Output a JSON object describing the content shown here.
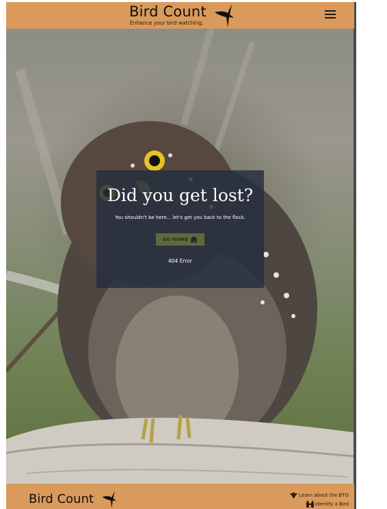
{
  "header": {
    "brand_title": "Bird Count",
    "brand_tagline": "Enhance your bird watching.",
    "menu_icon": "hamburger-menu-icon"
  },
  "hero": {
    "image_subject": "owl-photo"
  },
  "lost_card": {
    "title": "Did you get lost?",
    "subtitle": "You shouldn't be here... let's get you back to the flock.",
    "button_label": "GO HOME",
    "button_icon": "home-icon",
    "error_text": "404 Error"
  },
  "footer": {
    "brand_title": "Bird Count",
    "links": [
      {
        "label": "Learn about the BTO",
        "icon": "bird-icon"
      },
      {
        "label": "Identify a Bird",
        "icon": "binoculars-icon"
      }
    ]
  },
  "colors": {
    "header_bg": "#d99a5b",
    "card_bg": "#252d40",
    "button_bg": "#5d6a3c",
    "button_text": "#1f2338"
  }
}
